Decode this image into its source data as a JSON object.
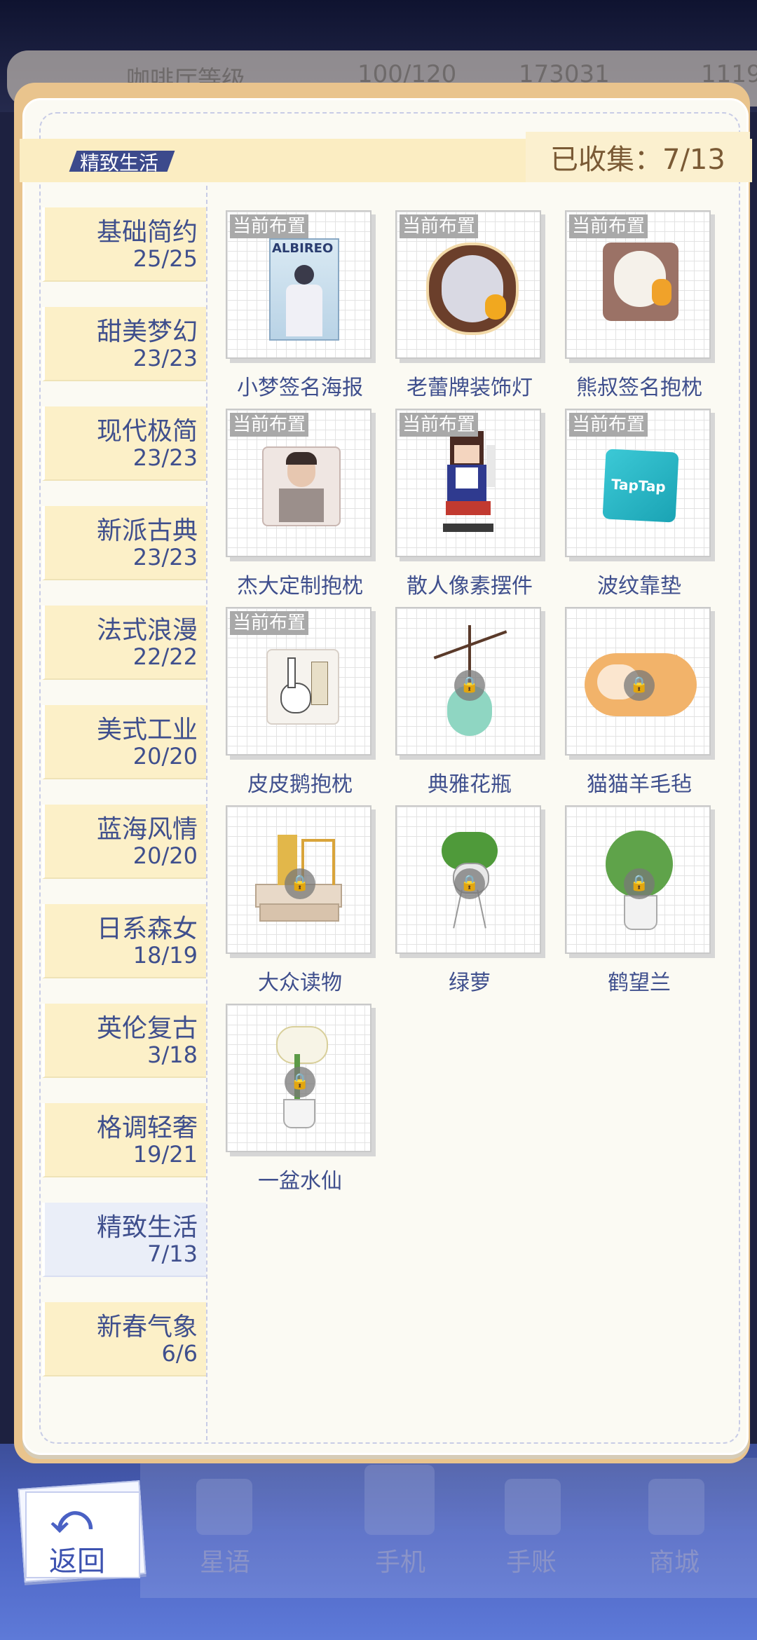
{
  "hud": {
    "cafe_level_label": "咖啡厅等级",
    "stamina": "100/120",
    "coins": "173031",
    "gems": "1119"
  },
  "panel": {
    "tag": "精致生活",
    "collected": "已收集：7/13"
  },
  "categories": [
    {
      "name": "基础简约",
      "count": "25/25"
    },
    {
      "name": "甜美梦幻",
      "count": "23/23"
    },
    {
      "name": "现代极简",
      "count": "23/23"
    },
    {
      "name": "新派古典",
      "count": "23/23"
    },
    {
      "name": "法式浪漫",
      "count": "22/22"
    },
    {
      "name": "美式工业",
      "count": "20/20"
    },
    {
      "name": "蓝海风情",
      "count": "20/20"
    },
    {
      "name": "日系森女",
      "count": "18/19"
    },
    {
      "name": "英伦复古",
      "count": "3/18"
    },
    {
      "name": "格调轻奢",
      "count": "19/21"
    },
    {
      "name": "精致生活",
      "count": "7/13"
    },
    {
      "name": "新春气象",
      "count": "6/6"
    }
  ],
  "badge_label": "当前布置",
  "items": [
    {
      "name": "小梦签名海报",
      "owned": true,
      "poster_text": "ALBIREO"
    },
    {
      "name": "老蕾牌装饰灯",
      "owned": true
    },
    {
      "name": "熊叔签名抱枕",
      "owned": true
    },
    {
      "name": "杰大定制抱枕",
      "owned": true
    },
    {
      "name": "散人像素摆件",
      "owned": true
    },
    {
      "name": "波纹靠垫",
      "owned": true,
      "pillow_text": "TapTap"
    },
    {
      "name": "皮皮鹅抱枕",
      "owned": true
    },
    {
      "name": "典雅花瓶",
      "owned": false
    },
    {
      "name": "猫猫羊毛毡",
      "owned": false
    },
    {
      "name": "大众读物",
      "owned": false
    },
    {
      "name": "绿萝",
      "owned": false
    },
    {
      "name": "鹤望兰",
      "owned": false
    },
    {
      "name": "一盆水仙",
      "owned": false
    }
  ],
  "nav": {
    "back": "返回",
    "items": [
      "星语",
      "手机",
      "手账",
      "商城"
    ]
  }
}
